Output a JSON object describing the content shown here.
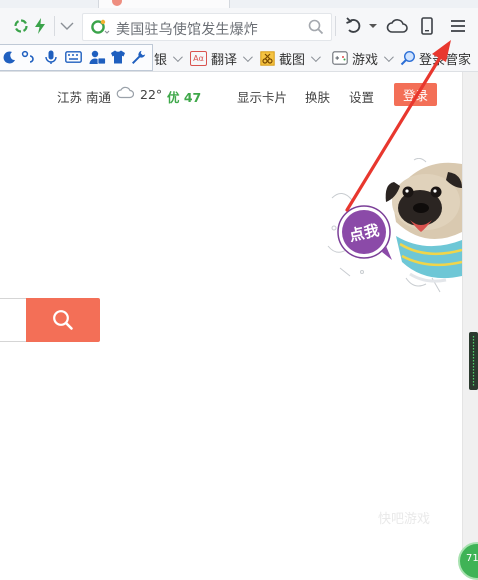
{
  "address_bar": {
    "value": "美国驻乌使馆发生爆炸"
  },
  "bookmarks": {
    "partial_item": "银",
    "items": [
      {
        "label": "翻译"
      },
      {
        "label": "截图"
      },
      {
        "label": "游戏"
      },
      {
        "label": "登录管家"
      }
    ]
  },
  "infobar": {
    "location": "江苏 南通",
    "temperature": "22°",
    "air_quality": "优 47",
    "links": [
      "显示卡片",
      "换肤",
      "设置"
    ],
    "login_label": "登录"
  },
  "mascot": {
    "badge_text": "点我"
  },
  "watermark": {
    "text": "快吧游戏"
  },
  "corner_badge": {
    "text": "71"
  },
  "colors": {
    "accent": "#f36f57",
    "air_good": "#3fa84a",
    "arrow": "#e8372e"
  }
}
